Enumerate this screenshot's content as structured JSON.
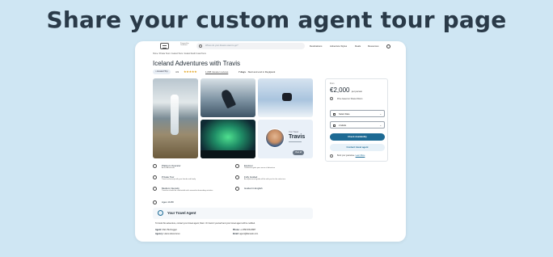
{
  "headline": "Share your custom agent tour page",
  "header": {
    "powered_by": "Powered by YouBoost",
    "search_placeholder": "Where do your dreams want to go?",
    "nav": [
      "Destinations",
      "Adventure Styles",
      "Deals",
      "Resources"
    ]
  },
  "breadcrumb": "Home  /  Private Tours  /  Iceland Tours  /  Iceland South Coast Tours",
  "tour": {
    "title": "Iceland Adventures with Travis",
    "hosted_badge": "Hosted Trip",
    "rating": "4.9",
    "stars": "★★★★★",
    "reviews": "1,088 traveler reviews",
    "duration": "7 days",
    "route": "Start and end in Reykjavík"
  },
  "agent_card": {
    "label": "Your Travel",
    "name": "Travis",
    "view_all": "View all"
  },
  "features": [
    {
      "title": "Platinum Operator",
      "sub": "Arctic Adventures"
    },
    {
      "title": "Explorer",
      "sub": "Curated to ignite your sense of adventure"
    },
    {
      "title": "Private Tour",
      "sub": "Travel exclusively with your friends and family"
    },
    {
      "title": "Fully Guided",
      "sub": "An experienced guide will be with you for the entire tour"
    },
    {
      "title": "Medium Intensity",
      "sub": "Travelers should be comfortable with somewhat demanding activities"
    },
    {
      "title": "Guided in English",
      "sub": ""
    },
    {
      "title": "Ages 10-80",
      "sub": ""
    }
  ],
  "booking": {
    "from_label": "From",
    "price": "€2,000",
    "per": "per person",
    "note": "Price based on Shared Room",
    "date_label": "Select Date",
    "guests_label": "2 Adults",
    "check_button": "Check Availability",
    "contact_button": "Contact travel agent",
    "guarantee": "Book your guarantee.",
    "learn_more": "Learn More"
  },
  "travel_agent": {
    "title": "Your Travel Agent",
    "body": "To book this adventure, contact your travel agent, Marc. Or book it yourself and your travel agent will be notified.",
    "agent_label": "Agent:",
    "agent_value": "Marc Buchegger",
    "agency_label": "Agency:",
    "agency_value": "Llama Adventures",
    "phone_label": "Phone:",
    "phone_value": "+1 858-539-8887",
    "email_label": "Email:",
    "email_value": "agent@llamado.com"
  }
}
